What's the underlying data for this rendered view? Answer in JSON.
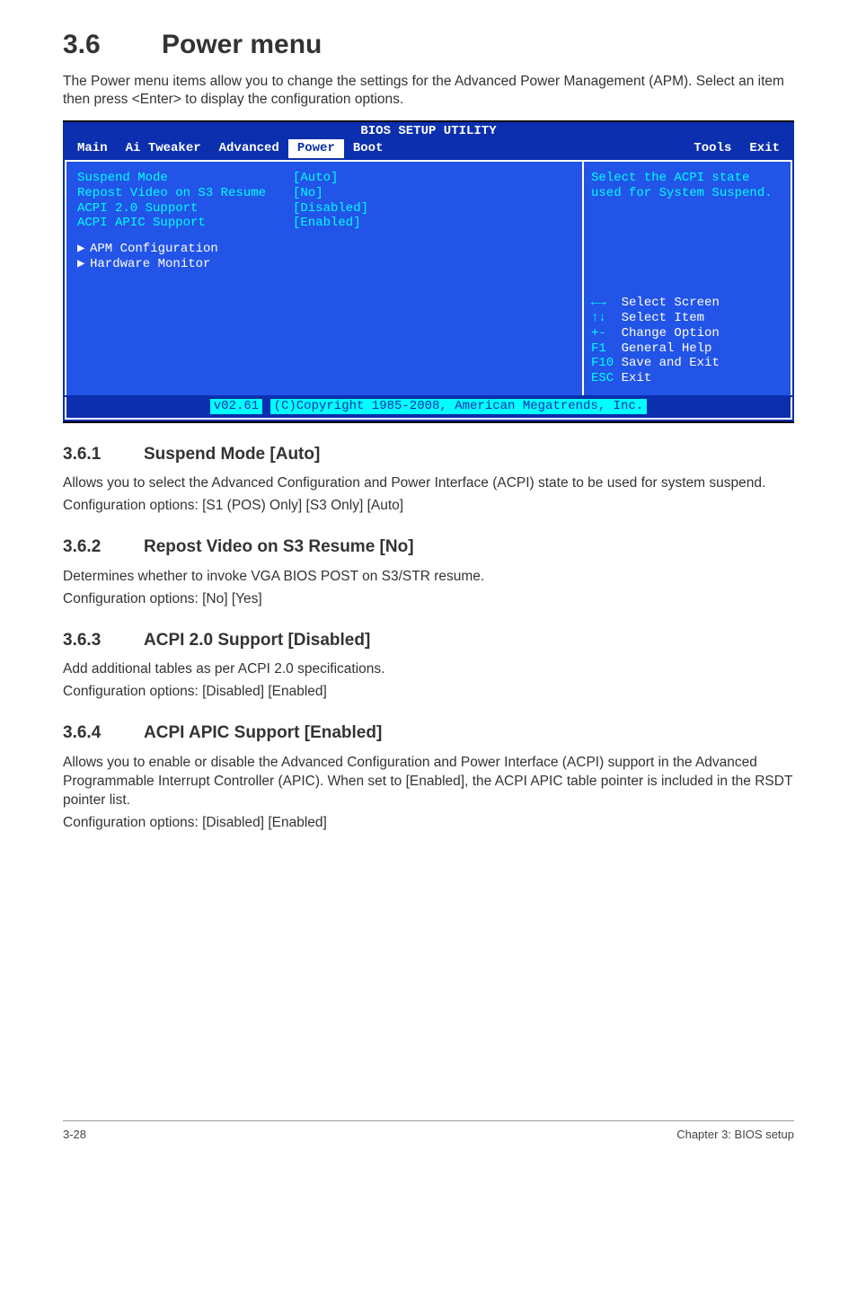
{
  "section": {
    "number": "3.6",
    "title": "Power menu"
  },
  "intro": "The Power menu items allow you to change the settings for the Advanced Power Management (APM). Select an item then press <Enter> to display the configuration options.",
  "bios": {
    "util_title": "BIOS SETUP UTILITY",
    "menus": [
      "Main",
      "Ai Tweaker",
      "Advanced",
      "Power",
      "Boot",
      "Tools",
      "Exit"
    ],
    "selected_menu": "Power",
    "settings": [
      {
        "label": "Suspend Mode",
        "value": "[Auto]"
      },
      {
        "label": "Repost Video on S3 Resume",
        "value": "[No]"
      },
      {
        "label": "ACPI 2.0 Support",
        "value": "[Disabled]"
      },
      {
        "label": "ACPI APIC Support",
        "value": "[Enabled]"
      }
    ],
    "subitems": [
      "APM Configuration",
      "Hardware Monitor"
    ],
    "help": "Select the ACPI state used for System Suspend.",
    "nav": [
      {
        "key": "←→",
        "label": "Select Screen"
      },
      {
        "key": "↑↓",
        "label": "Select Item"
      },
      {
        "key": "+-",
        "label": " Change Option"
      },
      {
        "key": "F1",
        "label": " General Help"
      },
      {
        "key": "F10",
        "label": "Save and Exit"
      },
      {
        "key": "ESC",
        "label": "Exit"
      }
    ],
    "footer_ver": "v02.61",
    "footer_copy": "(C)Copyright 1985-2008, American Megatrends, Inc."
  },
  "s361": {
    "num": "3.6.1",
    "title": "Suspend Mode [Auto]",
    "p1": "Allows you to select the Advanced Configuration and Power Interface (ACPI) state to be used for system suspend.",
    "p2": "Configuration options: [S1 (POS) Only] [S3 Only] [Auto]"
  },
  "s362": {
    "num": "3.6.2",
    "title": "Repost Video on S3 Resume [No]",
    "p1": "Determines whether to invoke VGA BIOS POST on S3/STR resume.",
    "p2": "Configuration options: [No] [Yes]"
  },
  "s363": {
    "num": "3.6.3",
    "title": "ACPI 2.0 Support [Disabled]",
    "p1": "Add additional tables as per ACPI 2.0 specifications.",
    "p2": "Configuration options: [Disabled] [Enabled]"
  },
  "s364": {
    "num": "3.6.4",
    "title": "ACPI APIC Support [Enabled]",
    "p1": "Allows you to enable or disable the Advanced Configuration and Power Interface (ACPI) support in the Advanced Programmable Interrupt Controller (APIC). When set to [Enabled], the ACPI APIC table pointer is included in the RSDT pointer list.",
    "p2": "Configuration options: [Disabled] [Enabled]"
  },
  "footer": {
    "left": "3-28",
    "right": "Chapter 3: BIOS setup"
  }
}
